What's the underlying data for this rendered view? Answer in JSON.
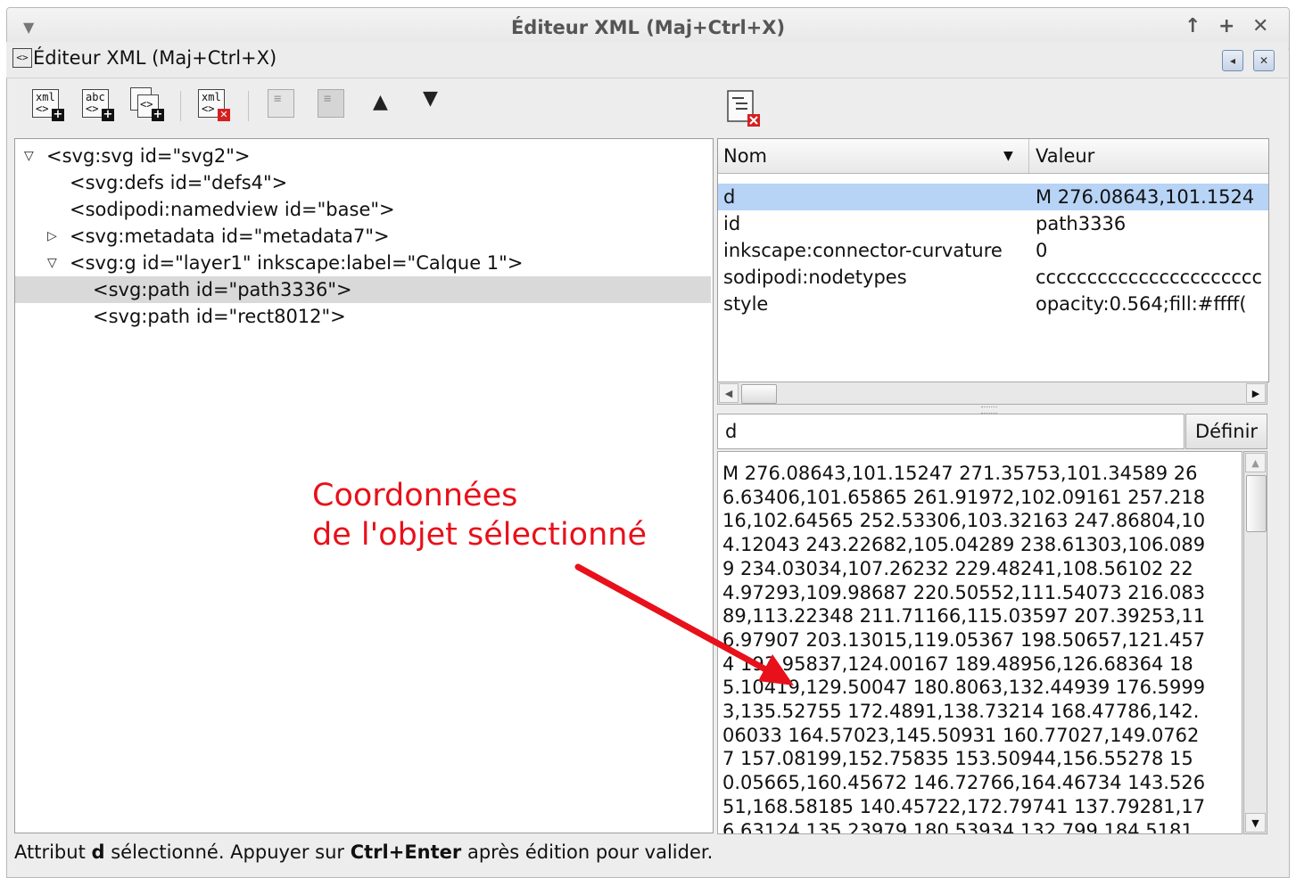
{
  "window": {
    "title": "Éditeur XML (Maj+Ctrl+X)",
    "controls": [
      "↑",
      "+",
      "✕"
    ]
  },
  "dock": {
    "title": "Éditeur XML (Maj+Ctrl+X)",
    "icon_label": "<>",
    "iconify_icon": "◂",
    "close_icon": "✕"
  },
  "toolbar": {
    "new_element_label": "xml",
    "new_text_label": "abc",
    "duplicate_label": "<>",
    "delete_label": "xml",
    "icons": [
      "new-element-node-icon",
      "new-text-node-icon",
      "duplicate-node-icon",
      "delete-node-icon",
      "unindent-node-icon",
      "indent-node-icon",
      "raise-node-icon",
      "lower-node-icon"
    ]
  },
  "tree": {
    "rows": [
      {
        "text": "<svg:svg id=\"svg2\">",
        "expander": "▽"
      },
      {
        "text": "<svg:defs id=\"defs4\">",
        "expander": ""
      },
      {
        "text": "<sodipodi:namedview id=\"base\">",
        "expander": ""
      },
      {
        "text": "<svg:metadata id=\"metadata7\">",
        "expander": "▷"
      },
      {
        "text": "<svg:g id=\"layer1\" inkscape:label=\"Calque 1\">",
        "expander": "▽"
      },
      {
        "text": "<svg:path id=\"path3336\">",
        "expander": ""
      },
      {
        "text": "<svg:path id=\"rect8012\">",
        "expander": ""
      }
    ]
  },
  "attributes": {
    "col_name": "Nom",
    "col_value": "Valeur",
    "rows": [
      {
        "name": "d",
        "value": "M 276.08643,101.1524"
      },
      {
        "name": "id",
        "value": "path3336"
      },
      {
        "name": "inkscape:connector-curvature",
        "value": "0"
      },
      {
        "name": "sodipodi:nodetypes",
        "value": "cccccccccccccccccccccc"
      },
      {
        "name": "style",
        "value": "opacity:0.564;fill:#ffff("
      }
    ]
  },
  "editor": {
    "attr_name": "d",
    "set_button": "Définir",
    "value_lines": [
      "M 276.08643,101.15247 271.35753,101.34589 26",
      "6.63406,101.65865 261.91972,102.09161 257.218",
      "16,102.64565 252.53306,103.32163 247.86804,10",
      "4.12043 243.22682,105.04289 238.61303,106.089",
      "9 234.03034,107.26232 229.48241,108.56102 22",
      "4.97293,109.98687 220.50552,111.54073 216.083",
      "89,113.22348 211.71166,115.03597 207.39253,11",
      "6.97907 203.13015,119.05367 198.50657,121.457",
      "4 193.95837,124.00167 189.48956,126.68364 18",
      "5.10419,129.50047 180.8063,132.44939 176.5999",
      "3,135.52755 172.4891,138.73214 168.47786,142.",
      "06033 164.57023,145.50931 160.77027,149.0762",
      "7 157.08199,152.75835 153.50944,156.55278 15",
      "0.05665,160.45672 146.72766,164.46734 143.526",
      "51,168.58185 140.45722,172.79741 137.79281,17",
      "6.63124 135.23979,180.53934 132.799,184.5181"
    ]
  },
  "status": {
    "prefix": "Attribut ",
    "attr": "d",
    "middle": " sélectionné. Appuyer sur ",
    "shortcut": "Ctrl+Enter",
    "suffix": " après édition pour valider."
  },
  "annotation": {
    "line1": "Coordonnées",
    "line2": "de l'objet sélectionné",
    "color": "#e8101a"
  }
}
